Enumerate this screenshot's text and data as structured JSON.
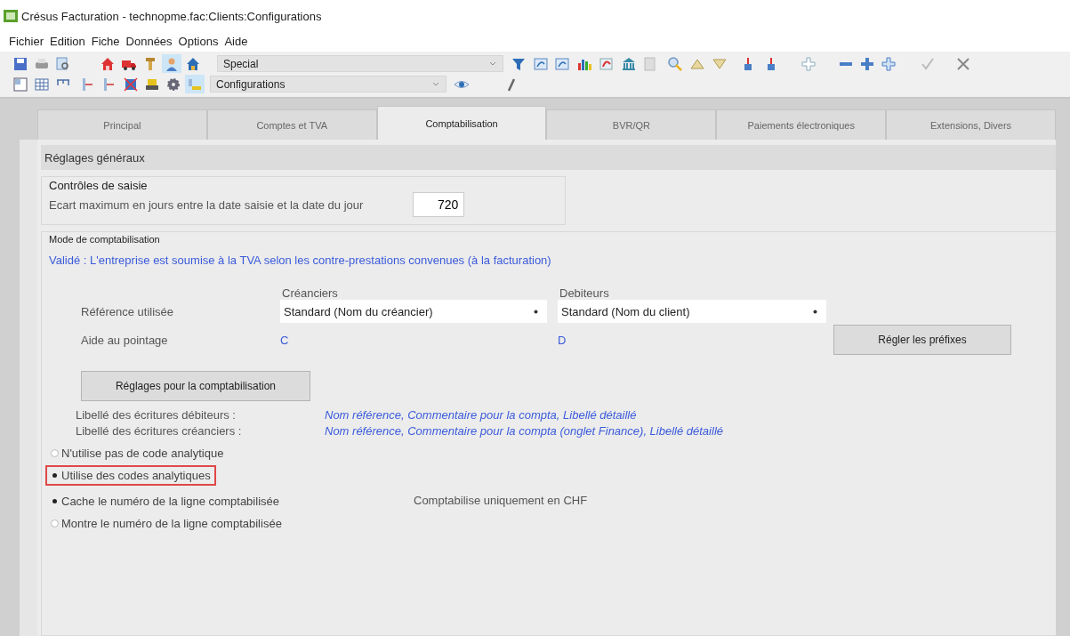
{
  "window": {
    "title": "Crésus Facturation - technopme.fac:Clients:Configurations"
  },
  "menu": [
    "Fichier",
    "Edition",
    "Fiche",
    "Données",
    "Options",
    "Aide"
  ],
  "toolbar_1": {
    "tools": [
      {
        "selected": false
      },
      {
        "selected": false
      },
      {
        "selected": false
      },
      {
        "selected": false
      },
      {
        "selected": false
      },
      {
        "selected": false
      },
      {
        "selected": true
      },
      {
        "selected": false
      }
    ],
    "combo": "Special"
  },
  "toolbar_2": {
    "tools": [
      {
        "selected": false
      },
      {
        "selected": false
      },
      {
        "selected": false
      },
      {
        "selected": false
      },
      {
        "selected": false
      },
      {
        "selected": false
      },
      {
        "selected": false
      },
      {
        "selected": false
      },
      {
        "selected": true
      }
    ],
    "combo": "Configurations"
  },
  "tabs": [
    {
      "label": "Principal",
      "selected": false
    },
    {
      "label": "Comptes et TVA",
      "selected": false
    },
    {
      "label": "Comptabilisation",
      "selected": true
    },
    {
      "label": "BVR/QR",
      "selected": false
    },
    {
      "label": "Paiements électroniques",
      "selected": false
    },
    {
      "label": "Extensions, Divers",
      "selected": false
    }
  ],
  "section_header": "Réglages généraux",
  "input_controls": {
    "title": "Contrôles de saisie",
    "label": "Ecart maximum en jours entre la date saisie et la date du jour",
    "value": "720"
  },
  "accounting_mode": {
    "title": "Mode de comptabilisation",
    "notice": "Validé : L'entreprise est soumise à la TVA selon les contre-prestations convenues (à la facturation)",
    "column_headers": [
      "Créanciers",
      "Debiteurs"
    ],
    "reference": {
      "label": "Référence utilisée",
      "values": [
        "Standard (Nom du créancier)",
        "Standard (Nom du client)"
      ]
    },
    "matching": {
      "label": "Aide au pointage",
      "values": [
        "C",
        "D"
      ]
    },
    "prefix_button": "Régler les préfixes",
    "settings_button": "Réglages pour la comptabilisation",
    "labels": [
      {
        "label": "Libellé des écritures débiteurs :",
        "value": "Nom référence, Commentaire pour la compta, Libellé détaillé"
      },
      {
        "label": "Libellé des écritures créanciers :",
        "value": "Nom référence, Commentaire pour la compta (onglet Finance), Libellé détaillé"
      }
    ],
    "analytics_options": [
      {
        "label": "N'utilise pas de code analytique",
        "selected": false,
        "highlighted": false
      },
      {
        "label": "Utilise des codes analytiques",
        "selected": true,
        "highlighted": true
      }
    ],
    "line_number_options": [
      {
        "label": "Cache le numéro de la ligne comptabilisée",
        "selected": true
      },
      {
        "label": "Montre le numéro de la ligne comptabilisée",
        "selected": false
      }
    ],
    "currency_note": "Comptabilise uniquement en CHF"
  }
}
